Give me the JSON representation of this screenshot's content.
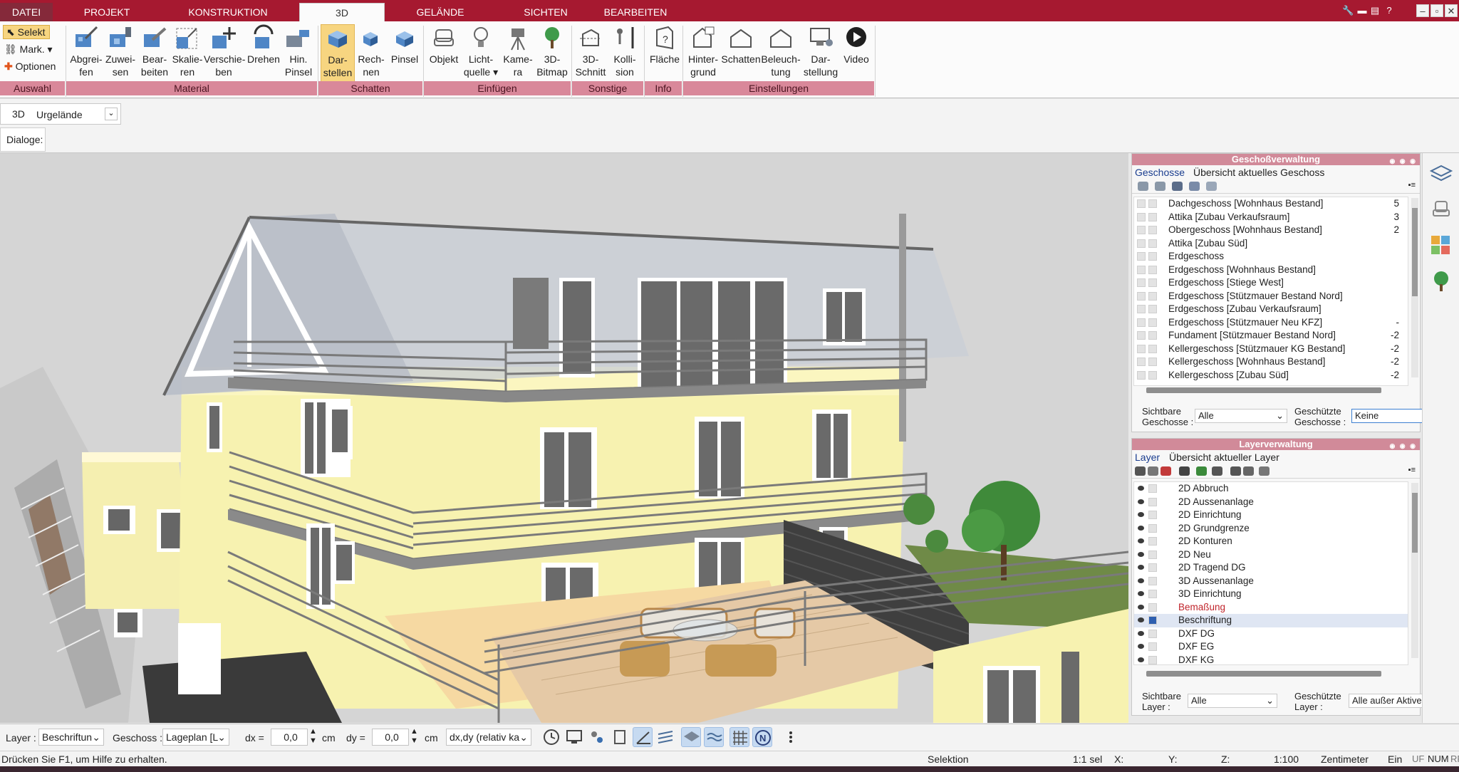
{
  "ribbon_tabs": [
    {
      "label": "DATEI"
    },
    {
      "label": "PROJEKT"
    },
    {
      "label": "KONSTRUKTION"
    },
    {
      "label": "3D"
    },
    {
      "label": "GELÄNDE"
    },
    {
      "label": "SICHTEN"
    },
    {
      "label": "BEARBEITEN"
    }
  ],
  "active_tab": "3D",
  "selection_tools": {
    "select_label": "Selekt",
    "mark_label": "Mark.",
    "options_label": "Optionen"
  },
  "ribbon_buttons": [
    {
      "label": "Abgrei-\nfen",
      "icon": "eyedropper-icon"
    },
    {
      "label": "Zuwei-\nsen",
      "icon": "assign-icon"
    },
    {
      "label": "Bear-\nbeiten",
      "icon": "edit-material-icon"
    },
    {
      "label": "Skalie-\nren",
      "icon": "scale-icon"
    },
    {
      "label": "Verschie-\nben",
      "icon": "move-icon"
    },
    {
      "label": "Drehen",
      "icon": "rotate-icon"
    },
    {
      "label": "Hin.\nPinsel",
      "icon": "paint-brush-icon"
    },
    {
      "label": "Dar-\nstellen",
      "icon": "shadow-display-icon"
    },
    {
      "label": "Rech-\nnen",
      "icon": "shadow-calc-icon"
    },
    {
      "label": "Pinsel",
      "icon": "shadow-brush-icon"
    },
    {
      "label": "Objekt",
      "icon": "armchair-icon"
    },
    {
      "label": "Licht-\nquelle ▾",
      "icon": "light-bulb-icon"
    },
    {
      "label": "Kame-\nra",
      "icon": "camera-icon"
    },
    {
      "label": "3D-\nBitmap",
      "icon": "tree-icon"
    },
    {
      "label": "3D-\nSchnitt",
      "icon": "section-cut-icon"
    },
    {
      "label": "Kolli-\nsion",
      "icon": "collision-icon"
    },
    {
      "label": "Fläche",
      "icon": "area-info-icon"
    },
    {
      "label": "Hinter-\ngrund",
      "icon": "background-icon"
    },
    {
      "label": "Schatten",
      "icon": "shadow-house-icon"
    },
    {
      "label": "Beleuch-\ntung",
      "icon": "lighting-icon"
    },
    {
      "label": "Dar-\nstellung",
      "icon": "display-settings-icon"
    },
    {
      "label": "Video",
      "icon": "play-icon"
    }
  ],
  "ribbon_groups": [
    {
      "label": "Auswahl"
    },
    {
      "label": "Material"
    },
    {
      "label": "Schatten"
    },
    {
      "label": "Einfügen"
    },
    {
      "label": "Sonstige"
    },
    {
      "label": "Info"
    },
    {
      "label": "Einstellungen"
    }
  ],
  "view_selector": {
    "mode": "3D",
    "value": "Urgelände"
  },
  "dialoge_label": "Dialoge:",
  "floor_panel": {
    "title": "Geschoßverwaltung",
    "tabs": [
      "Geschosse",
      "Übersicht aktuelles Geschoss"
    ],
    "floors": [
      {
        "name": "Dachgeschoss [Wohnhaus Bestand]",
        "level": "5"
      },
      {
        "name": "Attika [Zubau Verkaufsraum]",
        "level": "3"
      },
      {
        "name": "Obergeschoss [Wohnhaus Bestand]",
        "level": "2"
      },
      {
        "name": "Attika [Zubau Süd]",
        "level": ""
      },
      {
        "name": "Erdgeschoss",
        "level": ""
      },
      {
        "name": "Erdgeschoss [Wohnhaus Bestand]",
        "level": ""
      },
      {
        "name": "Erdgeschoss [Stiege West]",
        "level": ""
      },
      {
        "name": "Erdgeschoss [Stützmauer Bestand Nord]",
        "level": ""
      },
      {
        "name": "Erdgeschoss [Zubau Verkaufsraum]",
        "level": ""
      },
      {
        "name": "Erdgeschoss [Stützmauer Neu KFZ]",
        "level": "-"
      },
      {
        "name": "Fundament [Stützmauer Bestand Nord]",
        "level": "-2"
      },
      {
        "name": "Kellergeschoss [Stützmauer KG Bestand]",
        "level": "-2"
      },
      {
        "name": "Kellergeschoss [Wohnhaus Bestand]",
        "level": "-2"
      },
      {
        "name": "Kellergeschoss [Zubau Süd]",
        "level": "-2"
      }
    ],
    "visible_label": "Sichtbare\nGeschosse :",
    "visible_value": "Alle",
    "protected_label": "Geschützte\nGeschosse :",
    "protected_value": "Keine"
  },
  "layer_panel": {
    "title": "Layerverwaltung",
    "tabs": [
      "Layer",
      "Übersicht aktueller Layer"
    ],
    "layers": [
      {
        "name": "2D Abbruch",
        "color": "#222222"
      },
      {
        "name": "2D Aussenanlage",
        "color": "#222222"
      },
      {
        "name": "2D Einrichtung",
        "color": "#222222"
      },
      {
        "name": "2D Grundgrenze",
        "color": "#222222"
      },
      {
        "name": "2D Konturen",
        "color": "#222222"
      },
      {
        "name": "2D Neu",
        "color": "#222222"
      },
      {
        "name": "2D Tragend DG",
        "color": "#222222"
      },
      {
        "name": "3D Aussenanlage",
        "color": "#222222"
      },
      {
        "name": "3D Einrichtung",
        "color": "#222222"
      },
      {
        "name": "Bemaßung",
        "color": "#c0242b"
      },
      {
        "name": "Beschriftung",
        "color": "#222222"
      },
      {
        "name": "DXF DG",
        "color": "#222222"
      },
      {
        "name": "DXF EG",
        "color": "#222222"
      },
      {
        "name": "DXF KG",
        "color": "#222222"
      }
    ],
    "selected_layer": "Beschriftung",
    "visible_label": "Sichtbare\nLayer :",
    "visible_value": "Alle",
    "protected_label": "Geschützte\nLayer :",
    "protected_value": "Alle außer Aktiver"
  },
  "bottom_toolbar": {
    "layer_label": "Layer :",
    "layer_value": "Beschriftun",
    "floor_label": "Geschoss :",
    "floor_value": "Lageplan [L",
    "dx_label": "dx =",
    "dx_value": "0,0",
    "dx_unit": "cm",
    "dy_label": "dy =",
    "dy_value": "0,0",
    "dy_unit": "cm",
    "mode_value": "dx,dy (relativ ka"
  },
  "status_bar": {
    "help": "Drücken Sie F1, um Hilfe zu erhalten.",
    "mode": "Selektion",
    "sel": "1:1 sel",
    "x": "X:",
    "y": "Y:",
    "z": "Z:",
    "scale": "1:100",
    "unit": "Zentimeter",
    "ein": "Ein",
    "uf": "UF",
    "num": "NUM",
    "rf": "RF"
  },
  "colors": {
    "accent": "#a61930",
    "group_bar": "#d9889a",
    "panel_title": "#d18a99",
    "facade": "#f7f2b0",
    "viewport_bg": "#d5d5d5"
  }
}
